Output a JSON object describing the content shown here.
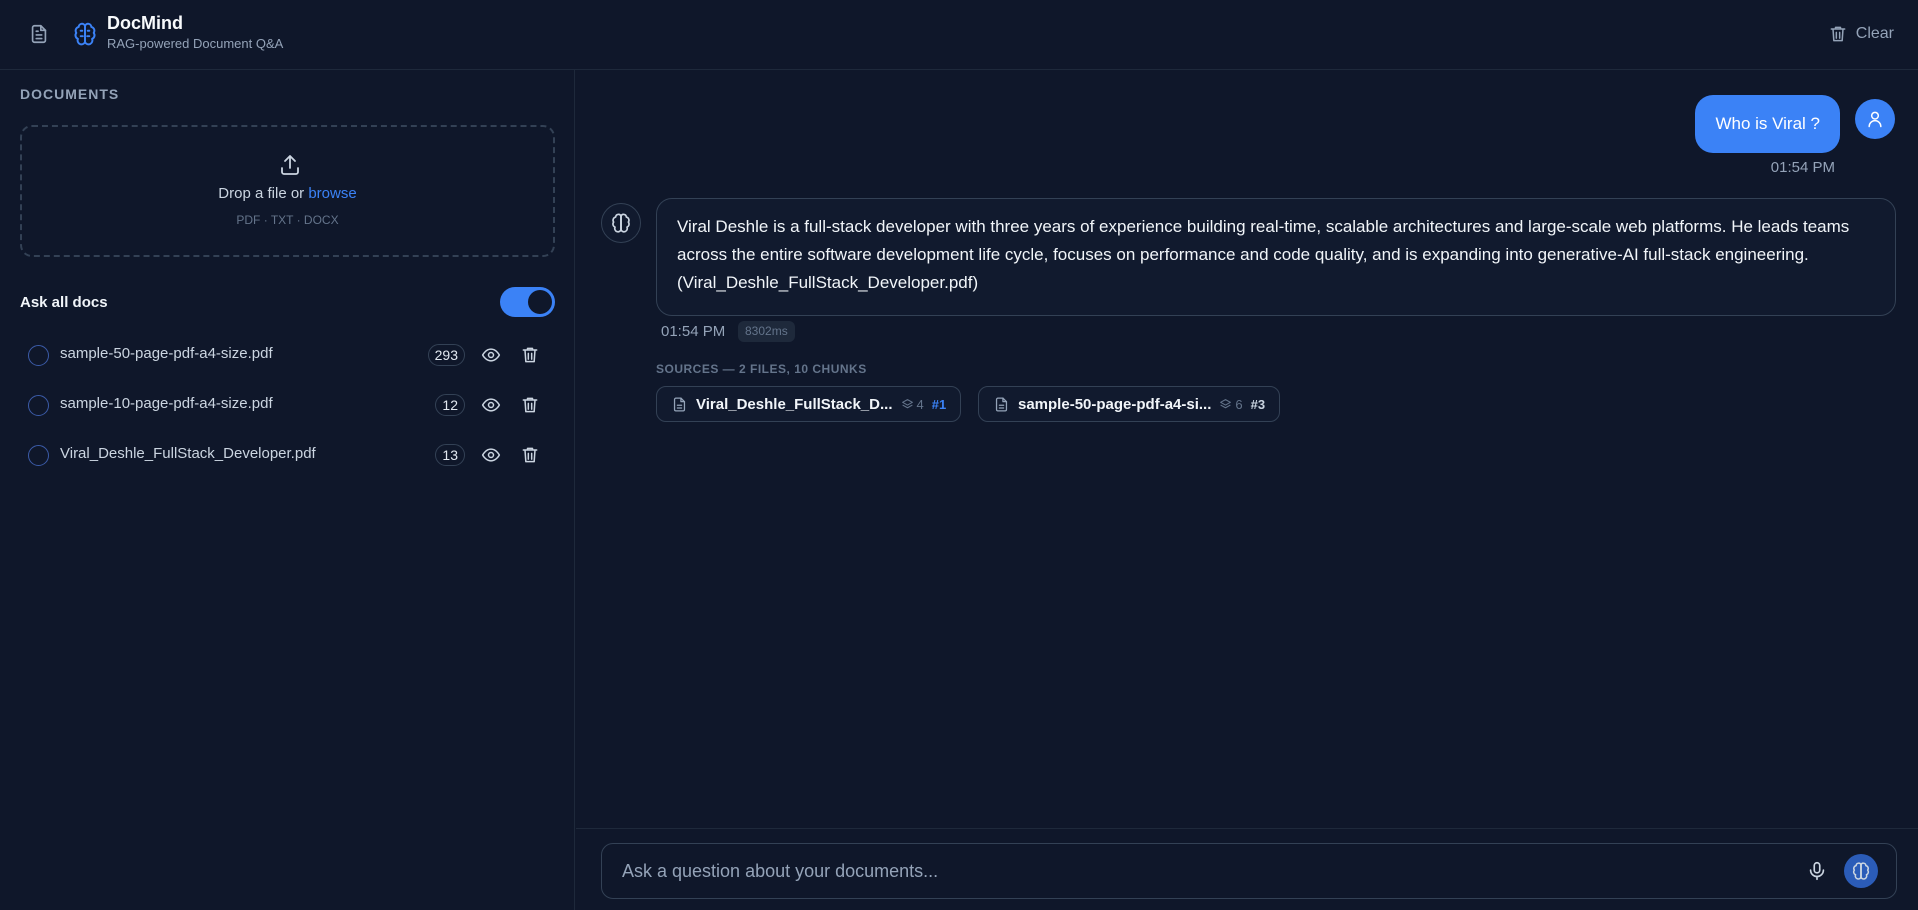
{
  "colors": {
    "accent": "#3b82f6",
    "background": "#0f172a",
    "border": "#334155"
  },
  "header": {
    "title": "DocMind",
    "subtitle": "RAG-powered Document Q&A",
    "clear_label": "Clear"
  },
  "sidebar": {
    "section_title": "DOCUMENTS",
    "dropzone": {
      "text": "Drop a file or ",
      "link": "browse",
      "hint": "PDF · TXT · DOCX"
    },
    "ask_all_label": "Ask all docs",
    "ask_all_enabled": true,
    "documents": [
      {
        "name": "sample-50-page-pdf-a4-size.pdf",
        "count": "293"
      },
      {
        "name": "sample-10-page-pdf-a4-size.pdf",
        "count": "12"
      },
      {
        "name": "Viral_Deshle_FullStack_Developer.pdf",
        "count": "13"
      }
    ]
  },
  "chat": {
    "user_message": {
      "text": "Who is Viral ?",
      "time": "01:54 PM"
    },
    "bot_message": {
      "text": "Viral Deshle is a full-stack developer with three years of experience building real-time, scalable architectures and large-scale web platforms. He leads teams across the entire software development life cycle, focuses on performance and code quality, and is expanding into generative-AI full-stack engineering. (Viral_Deshle_FullStack_Developer.pdf)",
      "time": "01:54 PM",
      "latency": "8302ms",
      "sources_label": "SOURCES — 2 FILES, 10 CHUNKS",
      "sources": [
        {
          "name": "Viral_Deshle_FullStack_D...",
          "chunks": "4",
          "rank": "#1",
          "rank_color": "#3b82f6"
        },
        {
          "name": "sample-50-page-pdf-a4-si...",
          "chunks": "6",
          "rank": "#3",
          "rank_color": "#cbd5e1"
        }
      ]
    }
  },
  "input": {
    "placeholder": "Ask a question about your documents..."
  }
}
